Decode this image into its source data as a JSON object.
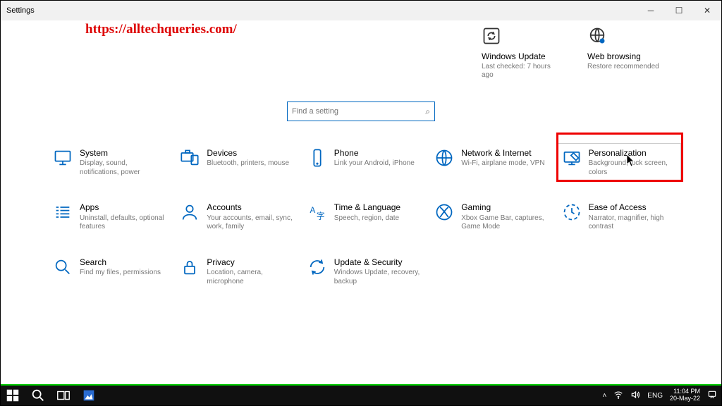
{
  "window": {
    "title": "Settings"
  },
  "watermark": "https://alltechqueries.com/",
  "top_tiles": [
    {
      "title": "Windows Update",
      "sub": "Last checked: 7 hours ago"
    },
    {
      "title": "Web browsing",
      "sub": "Restore recommended"
    }
  ],
  "search": {
    "placeholder": "Find a setting"
  },
  "categories": [
    {
      "title": "System",
      "sub": "Display, sound, notifications, power"
    },
    {
      "title": "Devices",
      "sub": "Bluetooth, printers, mouse"
    },
    {
      "title": "Phone",
      "sub": "Link your Android, iPhone"
    },
    {
      "title": "Network & Internet",
      "sub": "Wi-Fi, airplane mode, VPN"
    },
    {
      "title": "Personalization",
      "sub": "Background, lock screen, colors"
    },
    {
      "title": "Apps",
      "sub": "Uninstall, defaults, optional features"
    },
    {
      "title": "Accounts",
      "sub": "Your accounts, email, sync, work, family"
    },
    {
      "title": "Time & Language",
      "sub": "Speech, region, date"
    },
    {
      "title": "Gaming",
      "sub": "Xbox Game Bar, captures, Game Mode"
    },
    {
      "title": "Ease of Access",
      "sub": "Narrator, magnifier, high contrast"
    },
    {
      "title": "Search",
      "sub": "Find my files, permissions"
    },
    {
      "title": "Privacy",
      "sub": "Location, camera, microphone"
    },
    {
      "title": "Update & Security",
      "sub": "Windows Update, recovery, backup"
    }
  ],
  "taskbar": {
    "lang": "ENG",
    "time": "11:04 PM",
    "date": "20-May-22"
  }
}
